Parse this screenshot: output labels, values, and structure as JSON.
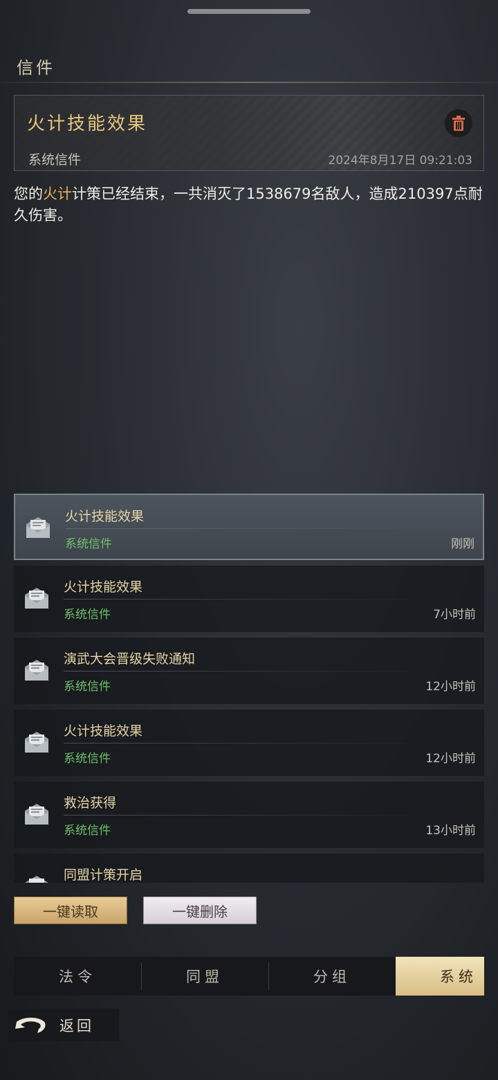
{
  "section_title": "信件",
  "detail": {
    "title": "火计技能效果",
    "sender": "系统信件",
    "time": "2024年8月17日 09:21:03",
    "body_prefix": "您的",
    "body_highlight": "火计",
    "body_rest": "计策已经结束，一共消灭了1538679名敌人，造成210397点耐久伤害。"
  },
  "mail_list": [
    {
      "title": "火计技能效果",
      "sender": "系统信件",
      "time": "刚刚"
    },
    {
      "title": "火计技能效果",
      "sender": "系统信件",
      "time": "7小时前"
    },
    {
      "title": "演武大会晋级失败通知",
      "sender": "系统信件",
      "time": "12小时前"
    },
    {
      "title": "火计技能效果",
      "sender": "系统信件",
      "time": "12小时前"
    },
    {
      "title": "救治获得",
      "sender": "系统信件",
      "time": "13小时前"
    },
    {
      "title": "同盟计策开启",
      "sender": "",
      "time": ""
    }
  ],
  "actions": {
    "read_all": "一键读取",
    "delete_all": "一键删除"
  },
  "tabs": [
    {
      "label": "法令"
    },
    {
      "label": "同盟"
    },
    {
      "label": "分组"
    },
    {
      "label": "系统"
    }
  ],
  "back_label": "返回",
  "icons": {
    "delete": "trash-icon",
    "mail": "envelope-icon",
    "back": "back-arrow-icon"
  },
  "colors": {
    "accent_gold": "#e8c77e",
    "sender_green": "#6fbf6a",
    "highlight": "#e8b15a"
  }
}
